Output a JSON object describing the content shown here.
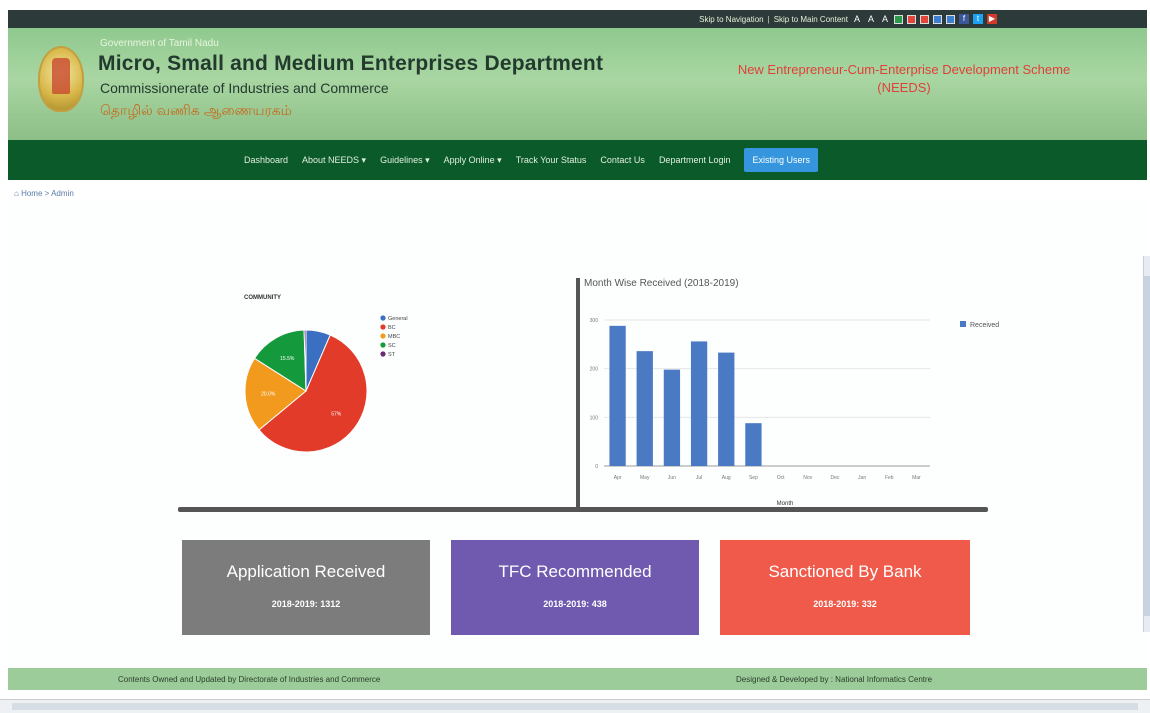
{
  "topbar": {
    "skip_nav": "Skip to Navigation",
    "skip_main": "Skip to Main Content",
    "font_sizes": [
      "A",
      "A",
      "A"
    ]
  },
  "header": {
    "govt": "Government of Tamil Nadu",
    "dept": "Micro, Small and Medium Enterprises Department",
    "commissionerate": "Commissionerate of Industries and Commerce",
    "tamil": "தொழில் வணிக ஆணையரகம்",
    "scheme_line1": "New Entrepreneur-Cum-Enterprise Development Scheme",
    "scheme_line2": "(NEEDS)"
  },
  "nav": {
    "items": [
      "Dashboard",
      "About NEEDS ▾",
      "Guidelines ▾",
      "Apply Online ▾",
      "Track Your Status",
      "Contact Us",
      "Department Login"
    ],
    "login_button": "Existing Users"
  },
  "breadcrumb": "Home > Admin",
  "pie": {
    "title": "COMMUNITY",
    "legend": [
      "General",
      "BC",
      "MBC",
      "SC",
      "ST"
    ],
    "colors": [
      "#3a6fc2",
      "#e23b2a",
      "#f29a1e",
      "#149a3c",
      "#6b2a74"
    ]
  },
  "chart_data": [
    {
      "type": "pie",
      "title": "COMMUNITY",
      "labels": [
        "General",
        "BC",
        "MBC",
        "SC",
        "ST"
      ],
      "values": [
        6.5,
        57.5,
        20.0,
        15.5,
        0.5
      ],
      "slice_labels": [
        "",
        "57%",
        "20.0%",
        "15.5%",
        ""
      ]
    },
    {
      "type": "bar",
      "title": "Month Wise Received (2018-2019)",
      "xlabel": "Month",
      "ylabel": "",
      "categories": [
        "Apr",
        "May",
        "Jun",
        "Jul",
        "Aug",
        "Sep",
        "Oct",
        "Nov",
        "Dec",
        "Jan",
        "Feb",
        "Mar"
      ],
      "series": [
        {
          "name": "Received",
          "values": [
            288,
            236,
            198,
            256,
            233,
            88,
            0,
            0,
            0,
            0,
            0,
            0
          ]
        }
      ],
      "ylim": [
        0,
        300
      ],
      "yticks": [
        0,
        100,
        200,
        300
      ],
      "legend": "right",
      "grid": true
    }
  ],
  "cards": [
    {
      "title": "Application Received",
      "value": "2018-2019: 1312"
    },
    {
      "title": "TFC Recommended",
      "value": "2018-2019: 438"
    },
    {
      "title": "Sanctioned By Bank",
      "value": "2018-2019: 332"
    }
  ],
  "footer": {
    "left": "Contents Owned and Updated by Directorate of Industries and Commerce",
    "right": "Designed & Developed by : National Informatics Centre"
  }
}
